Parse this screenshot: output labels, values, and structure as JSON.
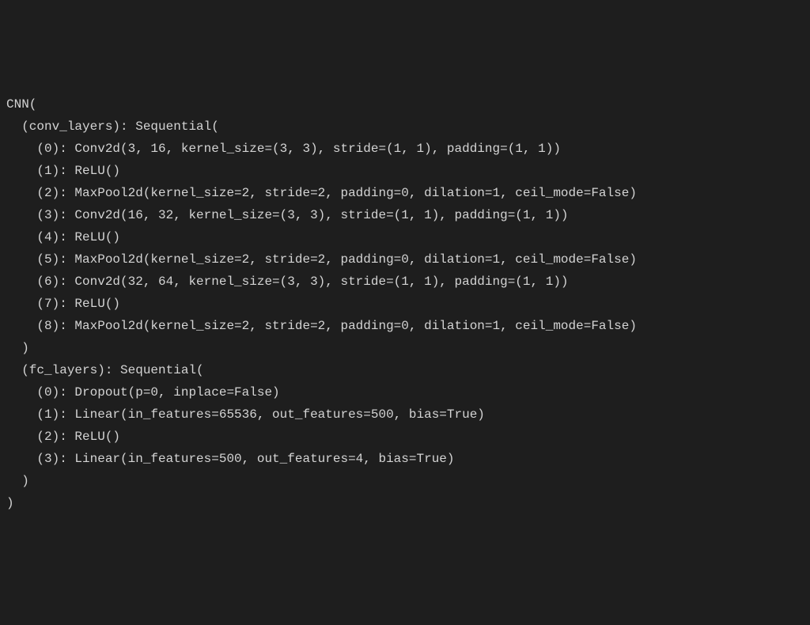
{
  "code": {
    "line0": "CNN(",
    "line1": "(conv_layers): Sequential(",
    "line2": "(0): Conv2d(3, 16, kernel_size=(3, 3), stride=(1, 1), padding=(1, 1))",
    "line3": "(1): ReLU()",
    "line4": "(2): MaxPool2d(kernel_size=2, stride=2, padding=0, dilation=1, ceil_mode=False)",
    "line5": "(3): Conv2d(16, 32, kernel_size=(3, 3), stride=(1, 1), padding=(1, 1))",
    "line6": "(4): ReLU()",
    "line7": "(5): MaxPool2d(kernel_size=2, stride=2, padding=0, dilation=1, ceil_mode=False)",
    "line8": "(6): Conv2d(32, 64, kernel_size=(3, 3), stride=(1, 1), padding=(1, 1))",
    "line9": "(7): ReLU()",
    "line10": "(8): MaxPool2d(kernel_size=2, stride=2, padding=0, dilation=1, ceil_mode=False)",
    "line11": ")",
    "line12": "(fc_layers): Sequential(",
    "line13": "(0): Dropout(p=0, inplace=False)",
    "line14": "(1): Linear(in_features=65536, out_features=500, bias=True)",
    "line15": "(2): ReLU()",
    "line16": "(3): Linear(in_features=500, out_features=4, bias=True)",
    "line17": ")",
    "line18": ")"
  }
}
